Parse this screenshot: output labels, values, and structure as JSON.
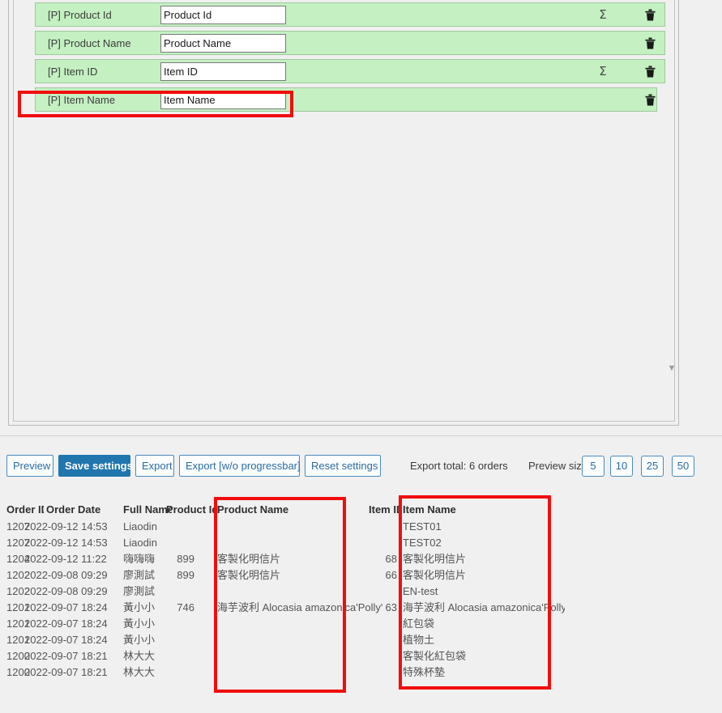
{
  "field_mapping": {
    "rows": [
      {
        "label": "[P] Product Id",
        "value": "Product Id",
        "has_sigma": true,
        "sigma": "Σ",
        "delete_icon": "trash-icon",
        "highlighted": false
      },
      {
        "label": "[P] Product Name",
        "value": "Product Name",
        "has_sigma": false,
        "sigma": "",
        "delete_icon": "trash-icon",
        "highlighted": false
      },
      {
        "label": "[P] Item ID",
        "value": "Item ID",
        "has_sigma": true,
        "sigma": "Σ",
        "delete_icon": "trash-icon",
        "highlighted": false
      },
      {
        "label": "[P] Item Name",
        "value": "Item Name",
        "has_sigma": false,
        "sigma": "",
        "delete_icon": "trash-icon",
        "highlighted": true
      }
    ],
    "scroll_down_icon": "▼",
    "row_color": "#c4f0c2",
    "highlight_color": "#f10d0d"
  },
  "toolbar": {
    "preview_label": "Preview",
    "save_label": "Save settings",
    "export_label": "Export",
    "export_no_progress_label": "Export [w/o progressbar]",
    "reset_label": "Reset settings",
    "export_total_label": "Export total: 6 orders",
    "preview_size_label": "Preview size",
    "preview_sizes": [
      "5",
      "10",
      "25",
      "50"
    ],
    "primary_color": "#2176ae"
  },
  "preview_table": {
    "headers": {
      "order_id": "Order ID",
      "order_date": "Order Date",
      "full_name": "Full Name",
      "product_id": "Product Id",
      "product_name": "Product Name",
      "item_id": "Item ID",
      "item_name": "Item Name"
    },
    "rows": [
      {
        "order_id": "1207",
        "order_date": "2022-09-12 14:53",
        "full_name": "Liaodin",
        "product_id": "",
        "product_name": "",
        "item_id": "",
        "item_name": "TEST01"
      },
      {
        "order_id": "1207",
        "order_date": "2022-09-12 14:53",
        "full_name": "Liaodin",
        "product_id": "",
        "product_name": "",
        "item_id": "",
        "item_name": "TEST02"
      },
      {
        "order_id": "1204",
        "order_date": "2022-09-12 11:22",
        "full_name": "嗨嗨嗨",
        "product_id": "899",
        "product_name": "客製化明信片",
        "item_id": "68",
        "item_name": "客製化明信片"
      },
      {
        "order_id": "1202",
        "order_date": "2022-09-08 09:29",
        "full_name": "廖測試",
        "product_id": "899",
        "product_name": "客製化明信片",
        "item_id": "66",
        "item_name": "客製化明信片"
      },
      {
        "order_id": "1202",
        "order_date": "2022-09-08 09:29",
        "full_name": "廖測試",
        "product_id": "",
        "product_name": "",
        "item_id": "",
        "item_name": "EN-test"
      },
      {
        "order_id": "1201",
        "order_date": "2022-09-07 18:24",
        "full_name": "黃小小",
        "product_id": "746",
        "product_name": "海芋波利 Alocasia amazonica'Polly'",
        "item_id": "63",
        "item_name": "海芋波利 Alocasia amazonica'Polly'"
      },
      {
        "order_id": "1201",
        "order_date": "2022-09-07 18:24",
        "full_name": "黃小小",
        "product_id": "",
        "product_name": "",
        "item_id": "",
        "item_name": "紅包袋"
      },
      {
        "order_id": "1201",
        "order_date": "2022-09-07 18:24",
        "full_name": "黃小小",
        "product_id": "",
        "product_name": "",
        "item_id": "",
        "item_name": "植物土"
      },
      {
        "order_id": "1200",
        "order_date": "2022-09-07 18:21",
        "full_name": "林大大",
        "product_id": "",
        "product_name": "",
        "item_id": "",
        "item_name": "客製化紅包袋"
      },
      {
        "order_id": "1200",
        "order_date": "2022-09-07 18:21",
        "full_name": "林大大",
        "product_id": "",
        "product_name": "",
        "item_id": "",
        "item_name": "特殊杯墊"
      }
    ],
    "highlighted_columns": [
      "product_name",
      "item_name"
    ]
  }
}
